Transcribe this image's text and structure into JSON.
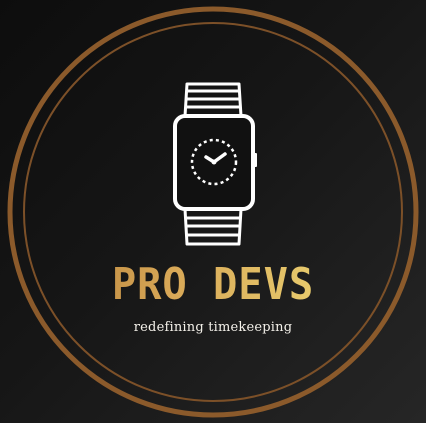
{
  "brand": {
    "name": "PRO DEVS",
    "tagline": "redefining timekeeping"
  },
  "icon": {
    "name": "smartwatch-icon",
    "clock_face": "clock-icon"
  },
  "colors": {
    "background_dark": "#0d0d0d",
    "background_light": "#262626",
    "ring_bronze": "#8b5a2b",
    "title_gold_start": "#b07a35",
    "title_gold_end": "#f0dc86",
    "icon_white": "#ffffff"
  }
}
